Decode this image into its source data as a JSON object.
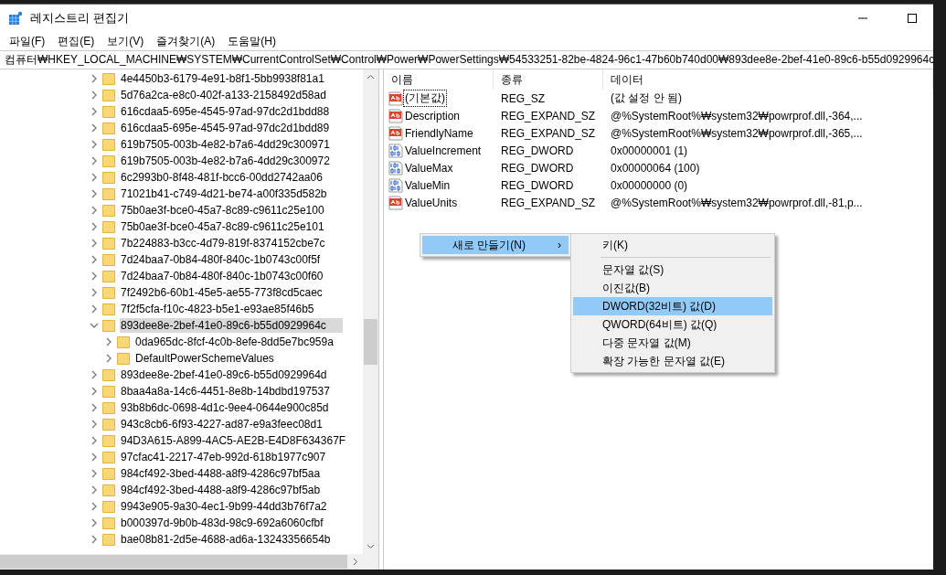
{
  "window": {
    "title": "레지스트리 편집기"
  },
  "menu_bar": [
    "파일(F)",
    "편집(E)",
    "보기(V)",
    "즐겨찾기(A)",
    "도움말(H)"
  ],
  "address": "컴퓨터₩HKEY_LOCAL_MACHINE₩SYSTEM₩CurrentControlSet₩Control₩Power₩PowerSettings₩54533251-82be-4824-96c1-47b60b740d00₩893dee8e-2bef-41e0-89c6-b55d0929964c",
  "tree": {
    "items": [
      {
        "label": "4e4450b3-6179-4e91-b8f1-5bb9938f81a1",
        "expanded": false,
        "selected": false
      },
      {
        "label": "5d76a2ca-e8c0-402f-a133-2158492d58ad",
        "expanded": false,
        "selected": false
      },
      {
        "label": "616cdaa5-695e-4545-97ad-97dc2d1bdd88",
        "expanded": false,
        "selected": false
      },
      {
        "label": "616cdaa5-695e-4545-97ad-97dc2d1bdd89",
        "expanded": false,
        "selected": false
      },
      {
        "label": "619b7505-003b-4e82-b7a6-4dd29c300971",
        "expanded": false,
        "selected": false
      },
      {
        "label": "619b7505-003b-4e82-b7a6-4dd29c300972",
        "expanded": false,
        "selected": false
      },
      {
        "label": "6c2993b0-8f48-481f-bcc6-00dd2742aa06",
        "expanded": false,
        "selected": false
      },
      {
        "label": "71021b41-c749-4d21-be74-a00f335d582b",
        "expanded": false,
        "selected": false
      },
      {
        "label": "75b0ae3f-bce0-45a7-8c89-c9611c25e100",
        "expanded": false,
        "selected": false
      },
      {
        "label": "75b0ae3f-bce0-45a7-8c89-c9611c25e101",
        "expanded": false,
        "selected": false
      },
      {
        "label": "7b224883-b3cc-4d79-819f-8374152cbe7c",
        "expanded": false,
        "selected": false
      },
      {
        "label": "7d24baa7-0b84-480f-840c-1b0743c00f5f",
        "expanded": false,
        "selected": false
      },
      {
        "label": "7d24baa7-0b84-480f-840c-1b0743c00f60",
        "expanded": false,
        "selected": false
      },
      {
        "label": "7f2492b6-60b1-45e5-ae55-773f8cd5caec",
        "expanded": false,
        "selected": false
      },
      {
        "label": "7f2f5cfa-f10c-4823-b5e1-e93ae85f46b5",
        "expanded": false,
        "selected": false
      },
      {
        "label": "893dee8e-2bef-41e0-89c6-b55d0929964c",
        "expanded": true,
        "selected": true,
        "children": [
          {
            "label": "0da965dc-8fcf-4c0b-8efe-8dd5e7bc959a",
            "expanded": false,
            "selected": false
          },
          {
            "label": "DefaultPowerSchemeValues",
            "expanded": false,
            "selected": false
          }
        ]
      },
      {
        "label": "893dee8e-2bef-41e0-89c6-b55d0929964d",
        "expanded": false,
        "selected": false
      },
      {
        "label": "8baa4a8a-14c6-4451-8e8b-14bdbd197537",
        "expanded": false,
        "selected": false
      },
      {
        "label": "93b8b6dc-0698-4d1c-9ee4-0644e900c85d",
        "expanded": false,
        "selected": false
      },
      {
        "label": "943c8cb6-6f93-4227-ad87-e9a3feec08d1",
        "expanded": false,
        "selected": false
      },
      {
        "label": "94D3A615-A899-4AC5-AE2B-E4D8F634367F",
        "expanded": false,
        "selected": false
      },
      {
        "label": "97cfac41-2217-47eb-992d-618b1977c907",
        "expanded": false,
        "selected": false
      },
      {
        "label": "984cf492-3bed-4488-a8f9-4286c97bf5aa",
        "expanded": false,
        "selected": false
      },
      {
        "label": "984cf492-3bed-4488-a8f9-4286c97bf5ab",
        "expanded": false,
        "selected": false
      },
      {
        "label": "9943e905-9a30-4ec1-9b99-44dd3b76f7a2",
        "expanded": false,
        "selected": false
      },
      {
        "label": "b000397d-9b0b-483d-98c9-692a6060cfbf",
        "expanded": false,
        "selected": false
      },
      {
        "label": "bae08b81-2d5e-4688-ad6a-13243356654b",
        "expanded": false,
        "selected": false
      }
    ]
  },
  "values": {
    "columns": [
      "이름",
      "종류",
      "데이터"
    ],
    "rows": [
      {
        "kind": "string",
        "name": "(기본값)",
        "type": "REG_SZ",
        "data": "(값 설정 안 됨)",
        "focused": true
      },
      {
        "kind": "string",
        "name": "Description",
        "type": "REG_EXPAND_SZ",
        "data": "@%SystemRoot%₩system32₩powrprof.dll,-364,...",
        "focused": false
      },
      {
        "kind": "string",
        "name": "FriendlyName",
        "type": "REG_EXPAND_SZ",
        "data": "@%SystemRoot%₩system32₩powrprof.dll,-365,...",
        "focused": false
      },
      {
        "kind": "binary",
        "name": "ValueIncrement",
        "type": "REG_DWORD",
        "data": "0x00000001 (1)",
        "focused": false
      },
      {
        "kind": "binary",
        "name": "ValueMax",
        "type": "REG_DWORD",
        "data": "0x00000064 (100)",
        "focused": false
      },
      {
        "kind": "binary",
        "name": "ValueMin",
        "type": "REG_DWORD",
        "data": "0x00000000 (0)",
        "focused": false
      },
      {
        "kind": "string",
        "name": "ValueUnits",
        "type": "REG_EXPAND_SZ",
        "data": "@%SystemRoot%₩system32₩powrprof.dll,-81,p...",
        "focused": false
      }
    ]
  },
  "context_menu": {
    "items": [
      {
        "label": "새로 만들기(N)",
        "arrow": "›",
        "selected": true
      }
    ],
    "submenu": [
      {
        "label": "키(K)",
        "selected": false,
        "separator_after": true
      },
      {
        "label": "문자열 값(S)",
        "selected": false,
        "separator_after": false
      },
      {
        "label": "이진값(B)",
        "selected": false,
        "separator_after": false
      },
      {
        "label": "DWORD(32비트) 값(D)",
        "selected": true,
        "separator_after": false
      },
      {
        "label": "QWORD(64비트) 값(Q)",
        "selected": false,
        "separator_after": false
      },
      {
        "label": "다중 문자열 값(M)",
        "selected": false,
        "separator_after": false
      },
      {
        "label": "확장 가능한 문자열 값(E)",
        "selected": false,
        "separator_after": false
      }
    ]
  }
}
